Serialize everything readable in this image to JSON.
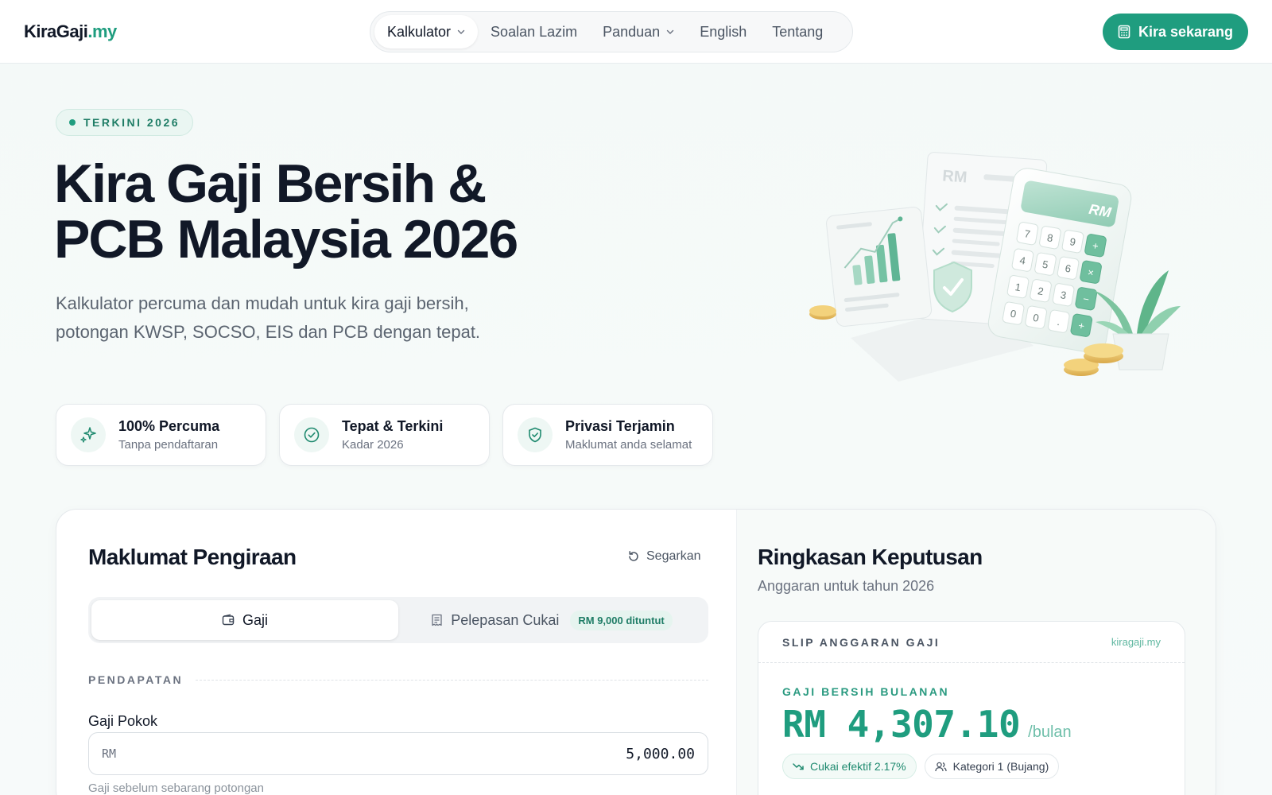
{
  "header": {
    "logo_main": "KiraGaji",
    "logo_tld": ".my",
    "nav": [
      {
        "label": "Kalkulator",
        "dropdown": true
      },
      {
        "label": "Soalan Lazim",
        "dropdown": false
      },
      {
        "label": "Panduan",
        "dropdown": true
      },
      {
        "label": "English",
        "dropdown": false
      },
      {
        "label": "Tentang",
        "dropdown": false
      }
    ],
    "cta_label": "Kira sekarang"
  },
  "hero": {
    "badge": "TERKINI 2026",
    "title_line1": "Kira Gaji Bersih &",
    "title_line2": "PCB Malaysia 2026",
    "subtitle": "Kalkulator percuma dan mudah untuk kira gaji bersih, potongan KWSP, SOCSO, EIS dan PCB dengan tepat.",
    "features": [
      {
        "title": "100% Percuma",
        "sub": "Tanpa pendaftaran",
        "icon": "sparkle-icon"
      },
      {
        "title": "Tepat & Terkini",
        "sub": "Kadar 2026",
        "icon": "check-circle-icon"
      },
      {
        "title": "Privasi Terjamin",
        "sub": "Maklumat anda selamat",
        "icon": "shield-check-icon"
      }
    ],
    "illustration_text": {
      "doc_rm": "RM",
      "calc_rm": "RM",
      "keys": [
        "7",
        "8",
        "9",
        "+",
        "4",
        "5",
        "6",
        "×",
        "1",
        "2",
        "3",
        "−",
        "0",
        "0",
        ".",
        "+"
      ]
    }
  },
  "form": {
    "title": "Maklumat Pengiraan",
    "reset_label": "Segarkan",
    "tabs": {
      "salary": "Gaji",
      "relief": "Pelepasan Cukai",
      "relief_chip": "RM 9,000 dituntut"
    },
    "section_label": "PENDAPATAN",
    "basic_salary_label": "Gaji Pokok",
    "basic_salary_prefix": "RM",
    "basic_salary_value": "5,000.00",
    "basic_salary_hint": "Gaji sebelum sebarang potongan"
  },
  "summary": {
    "title": "Ringkasan Keputusan",
    "subtitle": "Anggaran untuk tahun 2026",
    "slip_label": "SLIP ANGGARAN GAJI",
    "slip_site": "kiragaji.my",
    "net_label": "GAJI BERSIH BULANAN",
    "net_amount": "RM 4,307.10",
    "net_unit": "/bulan",
    "effective_tax": "Cukai efektif 2.17%",
    "category": "Kategori 1 (Bujang)"
  },
  "colors": {
    "accent": "#1f9d7f",
    "accent_light": "#eaf6f2",
    "text": "#111827",
    "muted": "#6b7280"
  }
}
